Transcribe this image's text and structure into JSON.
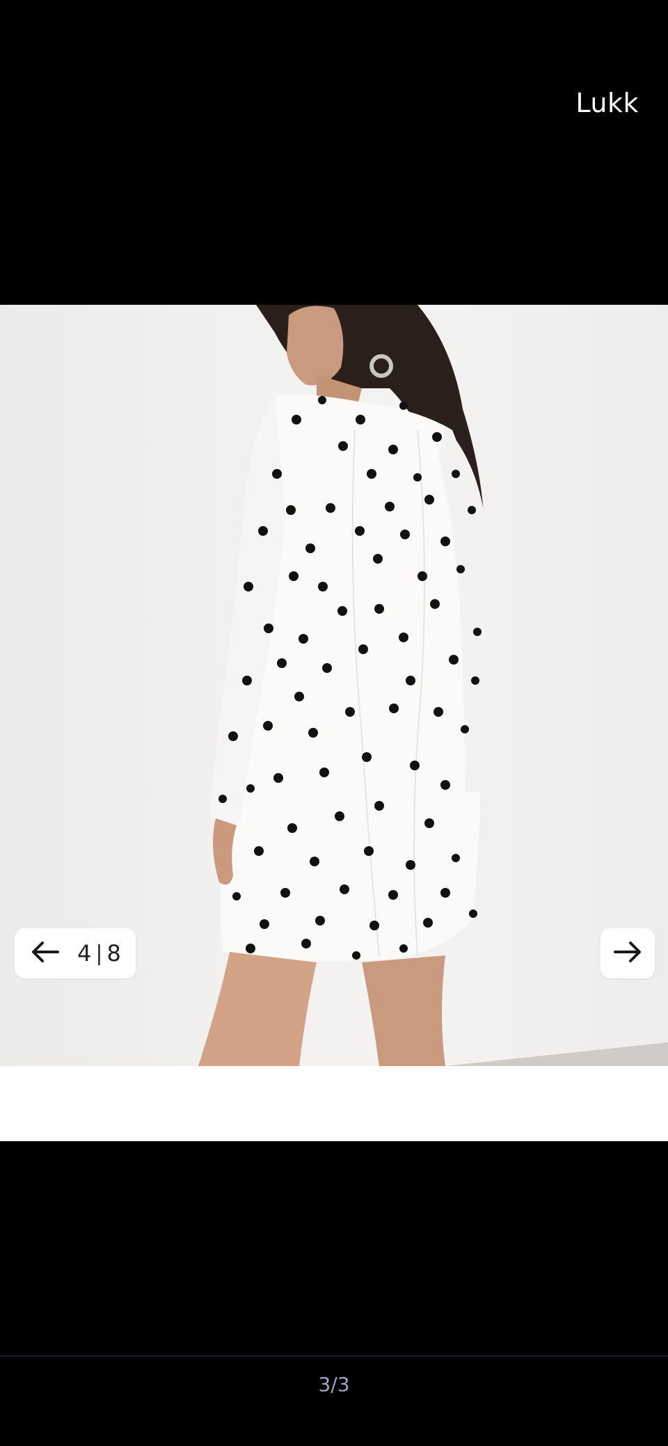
{
  "header": {
    "close_label": "Lukk"
  },
  "gallery": {
    "current": "4",
    "separator": "|",
    "total": "8",
    "prev_icon": "arrow-left-icon",
    "next_icon": "arrow-right-icon",
    "photo_description_icon": "product-photo"
  },
  "pager": {
    "label": "3/3"
  },
  "colors": {
    "background": "#000000",
    "panel": "#ffffff",
    "pager_text": "#9aa6c8"
  }
}
